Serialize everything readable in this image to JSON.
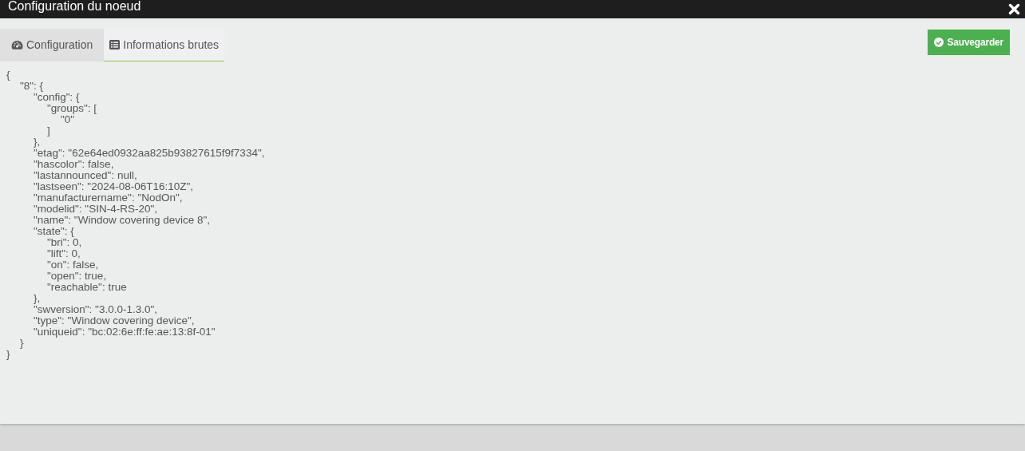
{
  "window": {
    "title": "Configuration du noeud"
  },
  "tabs": [
    {
      "label": "Configuration",
      "selected": false
    },
    {
      "label": "Informations brutes",
      "selected": true
    }
  ],
  "save_button": {
    "label": "Sauvegarder"
  },
  "raw_json": [
    {
      "text": "{",
      "children": [
        {
          "text": "\"8\": {",
          "children": [
            {
              "text": "\"config\": {",
              "children": [
                {
                  "text": "\"groups\": [",
                  "children": [
                    {
                      "text": "\"0\""
                    }
                  ]
                },
                {
                  "text": "]"
                }
              ]
            },
            {
              "text": "},"
            },
            {
              "text": "\"etag\": \"62e64ed0932aa825b93827615f9f7334\","
            },
            {
              "text": "\"hascolor\": false,"
            },
            {
              "text": "\"lastannounced\": null,"
            },
            {
              "text": "\"lastseen\": \"2024-08-06T16:10Z\","
            },
            {
              "text": "\"manufacturername\": \"NodOn\","
            },
            {
              "text": "\"modelid\": \"SIN-4-RS-20\","
            },
            {
              "text": "\"name\": \"Window covering device 8\","
            },
            {
              "text": "\"state\": {",
              "children": [
                {
                  "text": "\"bri\": 0,"
                },
                {
                  "text": "\"lift\": 0,"
                },
                {
                  "text": "\"on\": false,"
                },
                {
                  "text": "\"open\": true,"
                },
                {
                  "text": "\"reachable\": true"
                }
              ]
            },
            {
              "text": "},"
            },
            {
              "text": "\"swversion\": \"3.0.0-1.3.0\","
            },
            {
              "text": "\"type\": \"Window covering device\","
            },
            {
              "text": "\"uniqueid\": \"bc:02:6e:ff:fe:ae:13:8f-01\""
            }
          ]
        },
        {
          "text": "}"
        }
      ]
    },
    {
      "text": "}"
    }
  ]
}
